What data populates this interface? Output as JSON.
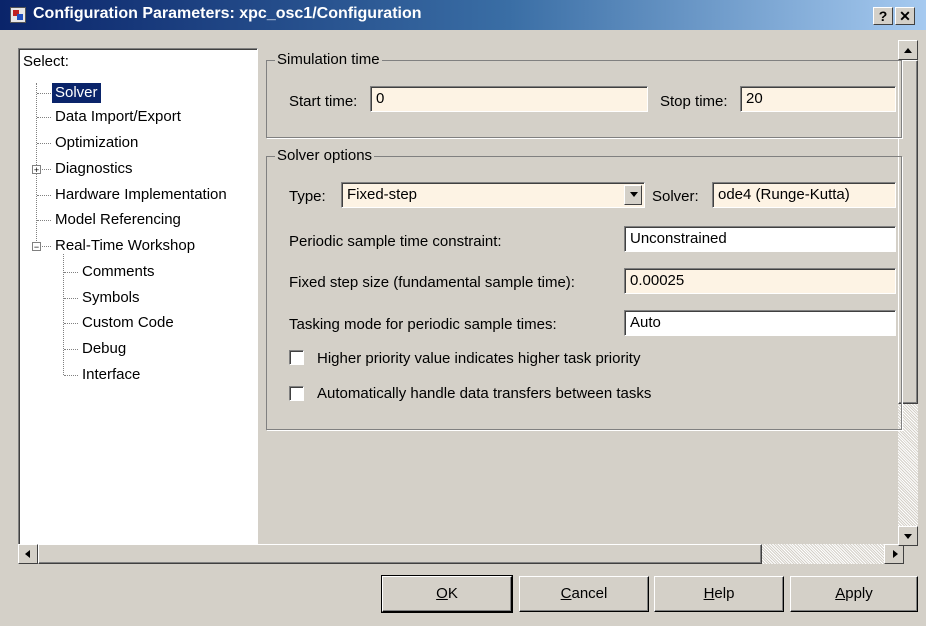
{
  "window": {
    "title": "Configuration Parameters: xpc_osc1/Configuration",
    "help_btn": "?",
    "close_btn": "✕"
  },
  "tree": {
    "header": "Select:",
    "items": [
      {
        "label": "Solver",
        "selected": true
      },
      {
        "label": "Data Import/Export"
      },
      {
        "label": "Optimization"
      },
      {
        "label": "Diagnostics",
        "expander": "+"
      },
      {
        "label": "Hardware Implementation"
      },
      {
        "label": "Model Referencing"
      },
      {
        "label": "Real-Time Workshop",
        "expander": "−"
      },
      {
        "label": "Comments"
      },
      {
        "label": "Symbols"
      },
      {
        "label": "Custom Code"
      },
      {
        "label": "Debug"
      },
      {
        "label": "Interface"
      }
    ]
  },
  "simulation_time": {
    "title": "Simulation time",
    "start_label": "Start time:",
    "start_value": "0",
    "stop_label": "Stop time:",
    "stop_value": "20"
  },
  "solver_options": {
    "title": "Solver options",
    "type_label": "Type:",
    "type_value": "Fixed-step",
    "solver_label": "Solver:",
    "solver_value": "ode4 (Runge-Kutta)",
    "periodic_label": "Periodic sample time constraint:",
    "periodic_value": "Unconstrained",
    "step_label": "Fixed step size (fundamental sample time):",
    "step_value": "0.00025",
    "tasking_label": "Tasking mode for periodic sample times:",
    "tasking_value": "Auto",
    "priority_label": "Higher priority value indicates higher task priority",
    "priority_checked": false,
    "transfer_label": "Automatically handle data transfers between tasks",
    "transfer_checked": false
  },
  "buttons": {
    "ok": {
      "mnemonic": "O",
      "rest": "K"
    },
    "cancel": {
      "mnemonic": "C",
      "rest": "ancel"
    },
    "help": {
      "mnemonic": "H",
      "rest": "elp"
    },
    "apply": {
      "mnemonic": "A",
      "rest": "pply"
    }
  },
  "colors": {
    "selection": "#0a246a",
    "field_bg": "#fdf3e4",
    "face": "#d4d0c8"
  }
}
